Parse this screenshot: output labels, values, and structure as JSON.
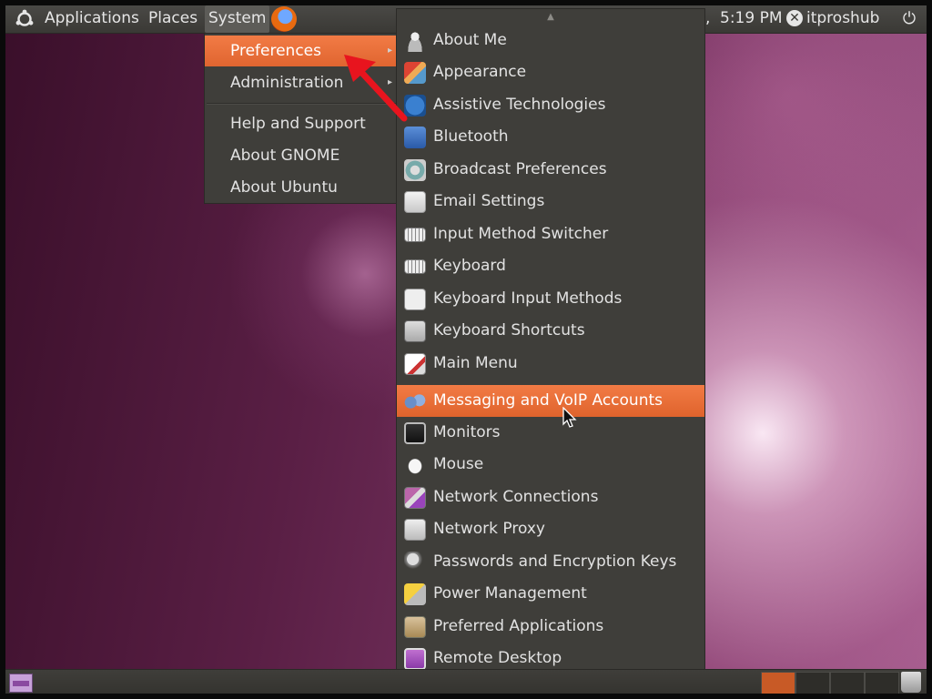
{
  "top_panel": {
    "menus": [
      "Applications",
      "Places",
      "System"
    ],
    "clock": "5:19 PM",
    "separator": ",",
    "user": "itproshub"
  },
  "system_menu": {
    "items": [
      {
        "label": "Preferences",
        "submenu": true,
        "highlighted": true
      },
      {
        "label": "Administration",
        "submenu": true
      },
      {
        "label": "Help and Support"
      },
      {
        "label": "About GNOME"
      },
      {
        "label": "About Ubuntu"
      }
    ]
  },
  "preferences_menu": {
    "items": [
      {
        "label": "About Me",
        "icon": "person-icon"
      },
      {
        "label": "Appearance",
        "icon": "appearance-icon"
      },
      {
        "label": "Assistive Technologies",
        "icon": "accessibility-icon"
      },
      {
        "label": "Bluetooth",
        "icon": "bluetooth-icon"
      },
      {
        "label": "Broadcast Preferences",
        "icon": "broadcast-icon"
      },
      {
        "label": "Email Settings",
        "icon": "email-icon"
      },
      {
        "label": "Input Method Switcher",
        "icon": "keyboard-icon"
      },
      {
        "label": "Keyboard",
        "icon": "keyboard-icon"
      },
      {
        "label": "Keyboard Input Methods",
        "icon": "info-icon"
      },
      {
        "label": "Keyboard Shortcuts",
        "icon": "shortcuts-icon"
      },
      {
        "label": "Main Menu",
        "icon": "main-menu-icon"
      },
      {
        "label": "Messaging and VoIP Accounts",
        "icon": "messaging-icon",
        "highlighted": true
      },
      {
        "label": "Monitors",
        "icon": "monitor-icon"
      },
      {
        "label": "Mouse",
        "icon": "mouse-icon"
      },
      {
        "label": "Network Connections",
        "icon": "network-icon"
      },
      {
        "label": "Network Proxy",
        "icon": "proxy-icon"
      },
      {
        "label": "Passwords and Encryption Keys",
        "icon": "keys-icon"
      },
      {
        "label": "Power Management",
        "icon": "power-management-icon"
      },
      {
        "label": "Preferred Applications",
        "icon": "preferred-apps-icon"
      },
      {
        "label": "Remote Desktop",
        "icon": "remote-desktop-icon"
      }
    ]
  },
  "colors": {
    "highlight": "#f07640",
    "panel": "#3c3b37",
    "annotation_arrow": "#e8141e"
  }
}
